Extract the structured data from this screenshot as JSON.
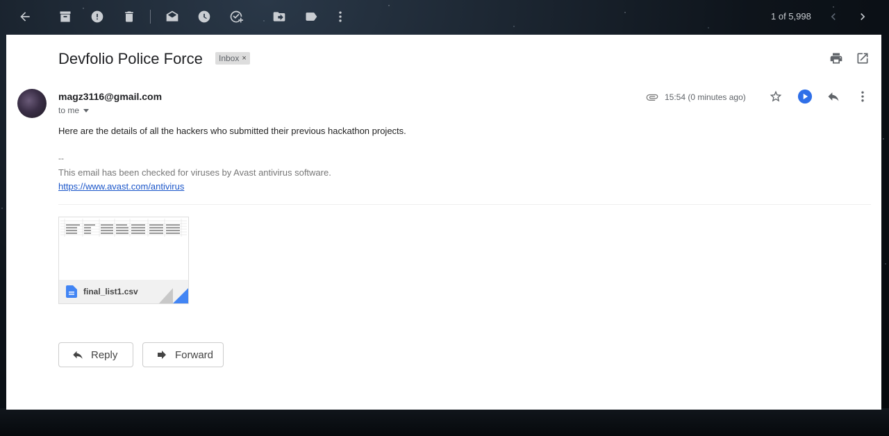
{
  "toolbar": {
    "pager": "1 of 5,998"
  },
  "email": {
    "subject": "Devfolio Police Force",
    "label": "Inbox",
    "label_remove": "×",
    "sender": "magz3116@gmail.com",
    "recipient": "to me",
    "time": "15:54 (0 minutes ago)",
    "body": "Here are the details of all the hackers who submitted their previous hackathon projects.",
    "signature_dash": "--",
    "signature_text": "This email has been checked for viruses by Avast antivirus software.",
    "signature_link": "https://www.avast.com/antivirus"
  },
  "attachment": {
    "filename": "final_list1.csv"
  },
  "actions": {
    "reply_label": "Reply",
    "forward_label": "Forward"
  },
  "colors": {
    "play_button": "#2f6fe8",
    "link": "#1a55c9",
    "doc_icon": "#4285f4"
  }
}
